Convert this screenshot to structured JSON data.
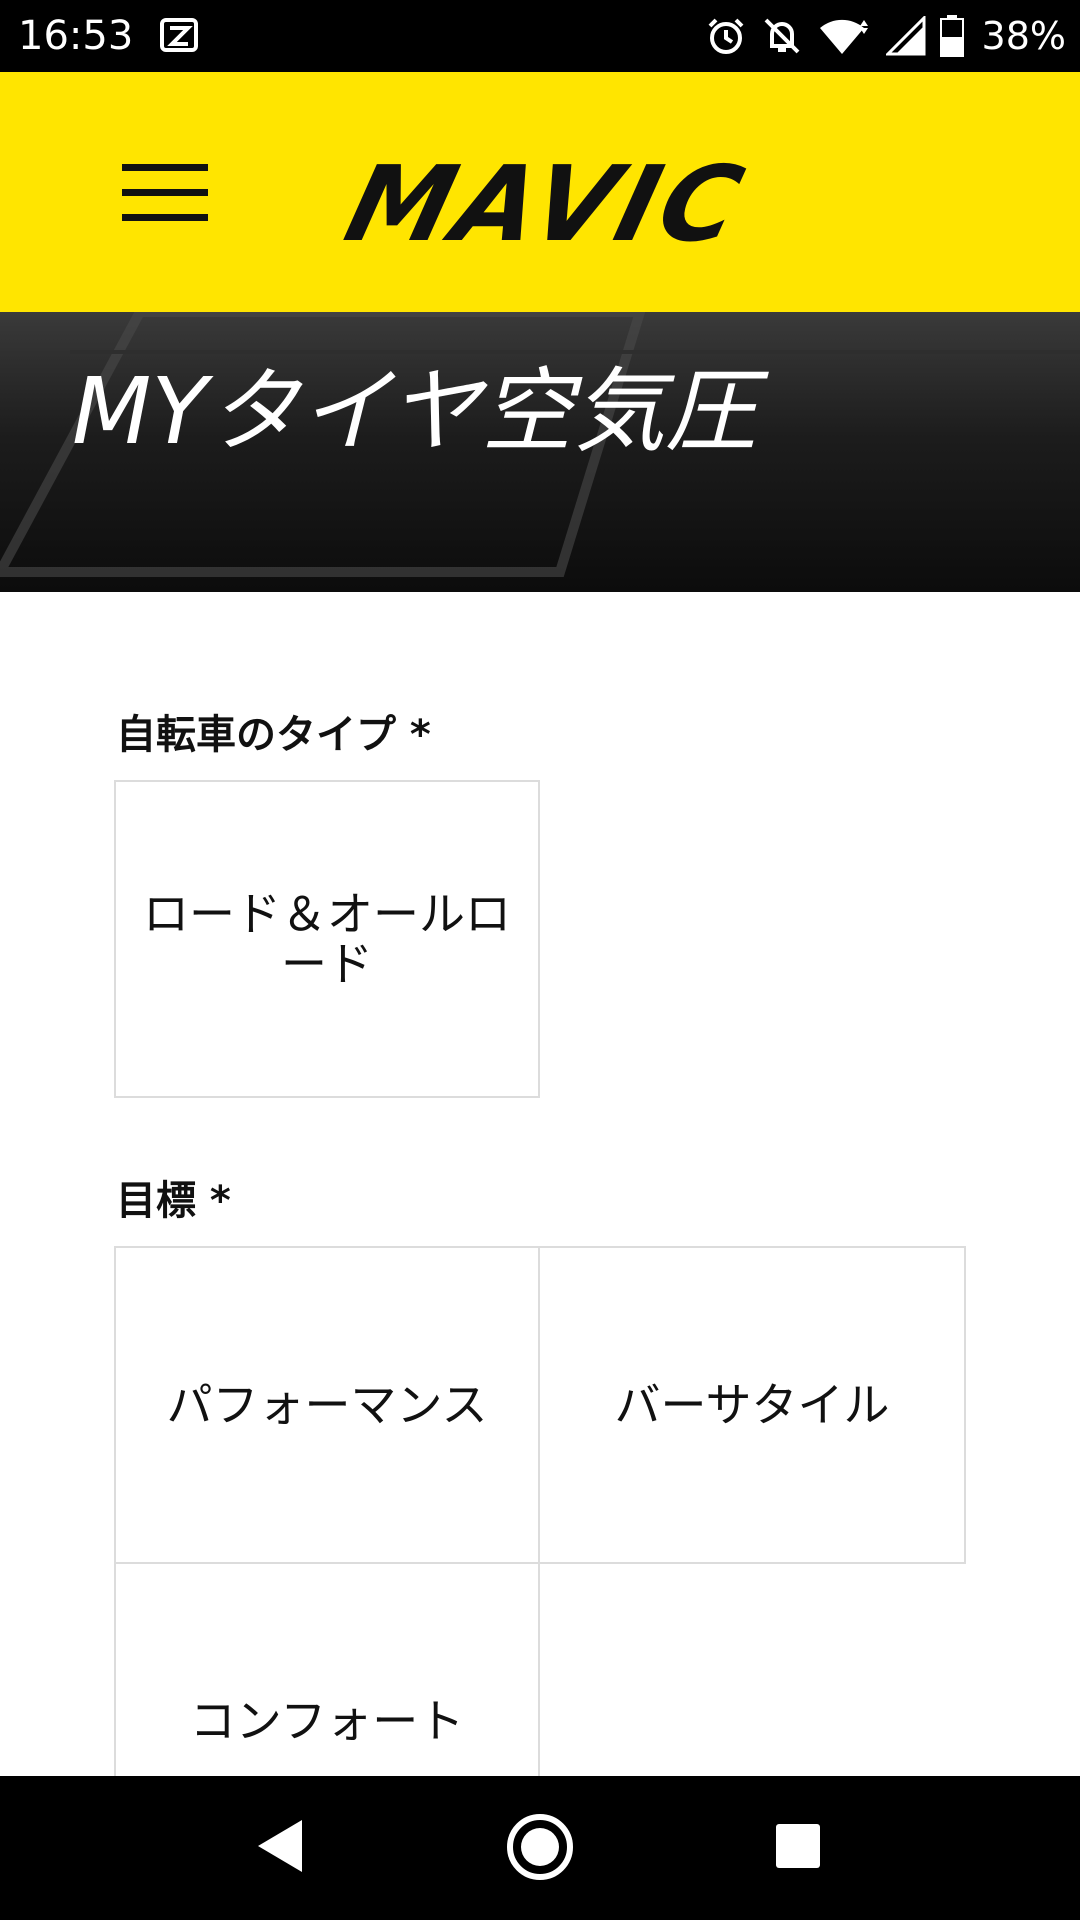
{
  "status_bar": {
    "time": "16:53",
    "battery": "38%",
    "icons": [
      "app-notification-icon",
      "alarm-icon",
      "notifications-off-icon",
      "wifi-icon",
      "signal-icon",
      "battery-icon"
    ]
  },
  "header": {
    "logo_text": "MAVIC",
    "menu_icon": "hamburger-menu-icon",
    "background": "#ffe500"
  },
  "hero": {
    "title": "MYタイヤ空気圧"
  },
  "form": {
    "bike_type": {
      "label": "自転車のタイプ *",
      "options": [
        "ロード＆オールロード"
      ]
    },
    "goal": {
      "label": "目標 *",
      "options": [
        "パフォーマンス",
        "バーサタイル",
        "コンフォート"
      ]
    }
  },
  "nav_bar": {
    "icons": [
      "back-icon",
      "home-icon",
      "recents-icon"
    ]
  }
}
